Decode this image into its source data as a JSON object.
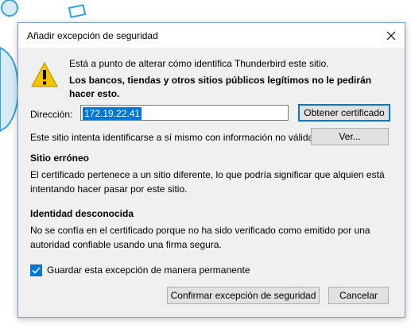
{
  "dialog": {
    "title": "Añadir excepción de seguridad",
    "message": "Está a punto de alterar cómo identifica Thunderbird este sitio.",
    "warning": "Los bancos, tiendas y otros sitios públicos legítimos no le pedirán hacer esto.",
    "location_label": "Dirección:",
    "location_value": "172.19.22.41",
    "get_certificate_label": "Obtener certificado",
    "invalid_info": "Este sitio intenta identificarse a sí mismo con información no válida.",
    "view_label": "Ver...",
    "wrong_site_heading": "Sitio erróneo",
    "wrong_site_text": "El certificado pertenece a un sitio diferente, lo que podría significar que alquien está intentando hacer pasar por este sitio.",
    "unknown_identity_heading": "Identidad desconocida",
    "unknown_identity_text": "No se confía en el certificado porque no ha sido verificado como emitido por una autoridad confiable usando una firma segura.",
    "permanent_label": "Guardar esta excepción de manera permanente",
    "permanent_checked": true,
    "confirm_label": "Confirmar excepción de seguridad",
    "cancel_label": "Cancelar"
  },
  "icons": {
    "close": "close-icon",
    "warning": "warning-icon",
    "check": "check-icon"
  },
  "colors": {
    "accent": "#0078d7",
    "warning_fill": "#f5c400"
  }
}
